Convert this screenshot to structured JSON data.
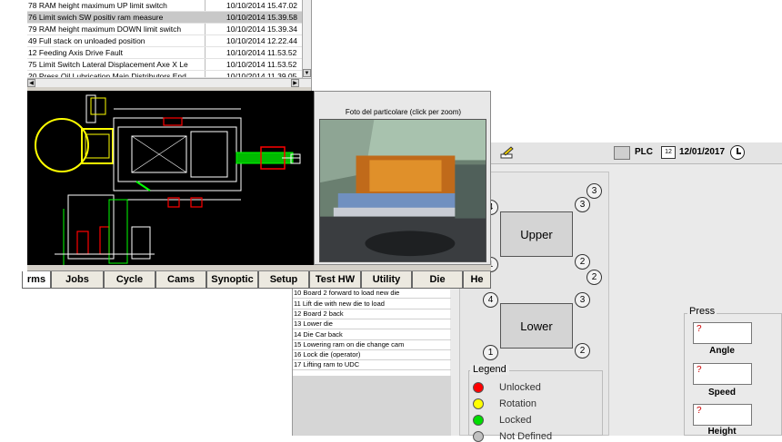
{
  "press_window": {
    "plc_label": "PLC",
    "calendar_icon": "calendar-icon",
    "date": "12/01/2017",
    "clock_icon": "clock-icon",
    "upper_label": "Upper",
    "lower_label": "Lower",
    "upper_clamps": [
      "4",
      "3",
      "1",
      "2",
      "3",
      "2"
    ],
    "lower_clamps": [
      "4",
      "3",
      "1",
      "2"
    ],
    "legend": {
      "title": "Legend",
      "items": [
        {
          "label": "Unlocked",
          "color": "#ff0000"
        },
        {
          "label": "Rotation",
          "color": "#ffff00"
        },
        {
          "label": "Locked",
          "color": "#00dd00"
        },
        {
          "label": "Not Defined",
          "color": "#c0c0c0"
        }
      ]
    },
    "press": {
      "title": "Press",
      "fields": [
        {
          "label": "Angle",
          "value": "?"
        },
        {
          "label": "Speed",
          "value": "?"
        },
        {
          "label": "Height",
          "value": "?"
        }
      ]
    }
  },
  "steps": [
    "10 Board 2 forward to load new die",
    "11 Lift die with new die to load",
    "12 Board 2 back",
    "13 Lower die",
    "14 Die Car back",
    "15 Lowering ram on die change cam",
    "16 Lock die (operator)",
    "17 Lifting ram to UDC"
  ],
  "alarms": [
    {
      "message": "78 RAM height maximum UP limit switch",
      "time": "10/10/2014 15.47.02",
      "selected": false
    },
    {
      "message": "76 Limit swich SW positiv ram measure",
      "time": "10/10/2014 15.39.58",
      "selected": true
    },
    {
      "message": "79 RAM height maximum DOWN limit switch",
      "time": "10/10/2014 15.39.34",
      "selected": false
    },
    {
      "message": "49 Full stack on unloaded position",
      "time": "10/10/2014 12.22.44",
      "selected": false
    },
    {
      "message": "12 Feeding Axis Drive Fault",
      "time": "10/10/2014 11.53.52",
      "selected": false
    },
    {
      "message": "75 Limit Switch Lateral Displacement Axe X Le",
      "time": "10/10/2014 11.53.52",
      "selected": false
    },
    {
      "message": "20 Press Oil Lubrication Main Distributors End",
      "time": "10/10/2014 11.39.05",
      "selected": false
    }
  ],
  "photo_caption": "Foto del particolare (click per zoom)",
  "tabs": [
    "rms",
    "Jobs",
    "Cycle",
    "Cams",
    "Synoptic",
    "Setup",
    "Test HW",
    "Utility",
    "Die",
    "He"
  ]
}
